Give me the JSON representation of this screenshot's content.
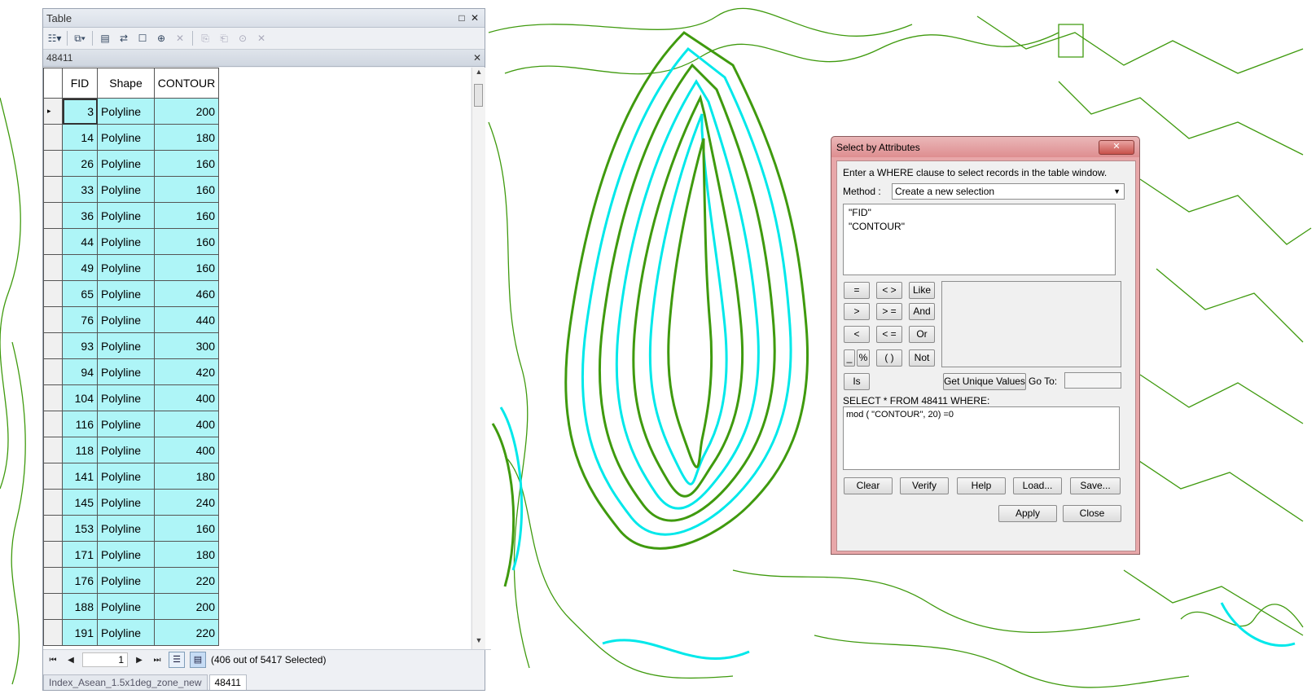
{
  "table_window": {
    "title": "Table",
    "layer_tab": "48411",
    "columns": [
      "FID",
      "Shape",
      "CONTOUR"
    ],
    "rows": [
      {
        "fid": "3",
        "shape": "Polyline",
        "contour": "200"
      },
      {
        "fid": "14",
        "shape": "Polyline",
        "contour": "180"
      },
      {
        "fid": "26",
        "shape": "Polyline",
        "contour": "160"
      },
      {
        "fid": "33",
        "shape": "Polyline",
        "contour": "160"
      },
      {
        "fid": "36",
        "shape": "Polyline",
        "contour": "160"
      },
      {
        "fid": "44",
        "shape": "Polyline",
        "contour": "160"
      },
      {
        "fid": "49",
        "shape": "Polyline",
        "contour": "160"
      },
      {
        "fid": "65",
        "shape": "Polyline",
        "contour": "460"
      },
      {
        "fid": "76",
        "shape": "Polyline",
        "contour": "440"
      },
      {
        "fid": "93",
        "shape": "Polyline",
        "contour": "300"
      },
      {
        "fid": "94",
        "shape": "Polyline",
        "contour": "420"
      },
      {
        "fid": "104",
        "shape": "Polyline",
        "contour": "400"
      },
      {
        "fid": "116",
        "shape": "Polyline",
        "contour": "400"
      },
      {
        "fid": "118",
        "shape": "Polyline",
        "contour": "400"
      },
      {
        "fid": "141",
        "shape": "Polyline",
        "contour": "180"
      },
      {
        "fid": "145",
        "shape": "Polyline",
        "contour": "240"
      },
      {
        "fid": "153",
        "shape": "Polyline",
        "contour": "160"
      },
      {
        "fid": "171",
        "shape": "Polyline",
        "contour": "180"
      },
      {
        "fid": "176",
        "shape": "Polyline",
        "contour": "220"
      },
      {
        "fid": "188",
        "shape": "Polyline",
        "contour": "200"
      },
      {
        "fid": "191",
        "shape": "Polyline",
        "contour": "220"
      }
    ],
    "current_record": "1",
    "selection_status": "(406 out of 5417 Selected)",
    "bottom_tabs": [
      "Index_Asean_1.5x1deg_zone_new",
      "48411"
    ]
  },
  "dialog": {
    "title": "Select by Attributes",
    "instruction": "Enter a WHERE clause to select records in the table window.",
    "method_label": "Method :",
    "method_value": "Create a new selection",
    "fields": [
      "\"FID\"",
      "\"CONTOUR\""
    ],
    "operators": [
      "=",
      "< >",
      "Like",
      ">",
      "> =",
      "And",
      "<",
      "< =",
      "Or",
      "_",
      "%",
      "( )",
      "Not",
      "Is"
    ],
    "get_unique_values": "Get Unique Values",
    "goto_label": "Go To:",
    "select_prefix": "SELECT * FROM 48411 WHERE:",
    "expression": "mod ( \"CONTOUR\", 20) =0",
    "buttons": [
      "Clear",
      "Verify",
      "Help",
      "Load...",
      "Save..."
    ],
    "apply": "Apply",
    "close": "Close"
  },
  "colors": {
    "contour_green": "#3f9a0e",
    "contour_selected": "#00f0f0",
    "grid_highlight": "#aef5f7",
    "dialog_frame": "#e8a7a9"
  },
  "icons": [
    "table-options-icon",
    "related-tables-icon",
    "select-by-attributes-icon",
    "switch-selection-icon",
    "clear-selection-icon",
    "zoom-to-selected-icon",
    "delete-selected-icon",
    "close-icon",
    "maximize-icon"
  ]
}
